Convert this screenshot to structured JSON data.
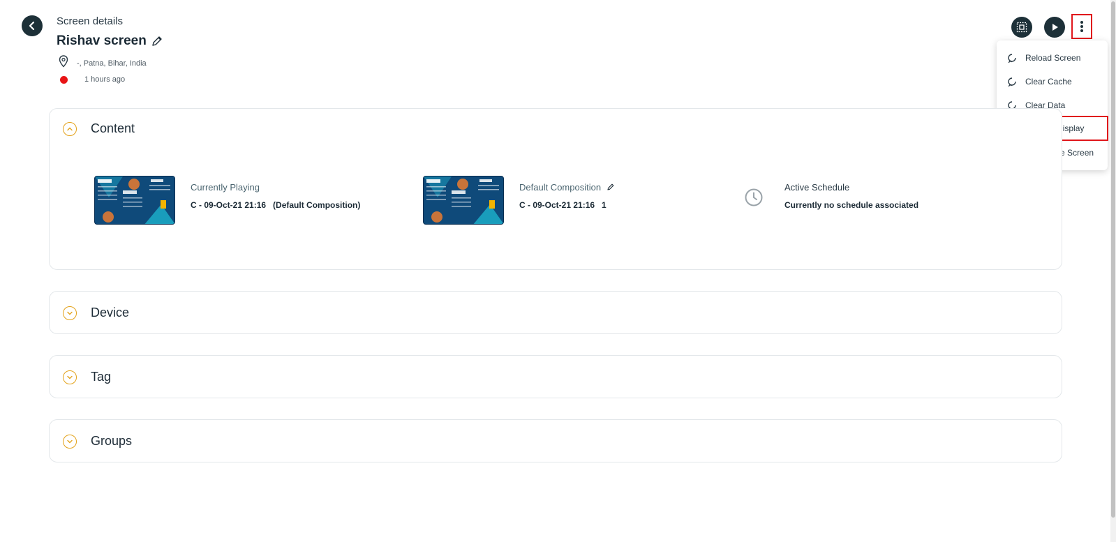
{
  "header": {
    "breadcrumb": "Screen details",
    "screen_name": "Rishav screen",
    "location": "-, Patna, Bihar, India",
    "last_seen": "1 hours ago",
    "status_color": "#e81416"
  },
  "menu": {
    "items": [
      {
        "label": "Reload Screen",
        "icon": "reload-icon"
      },
      {
        "label": "Clear Cache",
        "icon": "reload-icon"
      },
      {
        "label": "Clear Data",
        "icon": "reload-icon"
      },
      {
        "label": "Reboot Display",
        "icon": "refresh-icon"
      },
      {
        "label": "Deactivate Screen",
        "icon": "power-icon"
      }
    ]
  },
  "sections": {
    "content": {
      "title": "Content",
      "currently_playing": {
        "label": "Currently Playing",
        "value": "C - 09-Oct-21 21:16   (Default Composition)"
      },
      "default_composition": {
        "label": "Default Composition",
        "value": "C - 09-Oct-21 21:16   1"
      },
      "active_schedule": {
        "label": "Active Schedule",
        "value": "Currently no schedule associated"
      }
    },
    "device": {
      "title": "Device"
    },
    "tag": {
      "title": "Tag"
    },
    "groups": {
      "title": "Groups"
    }
  },
  "colors": {
    "accent": "#e3a21a",
    "dark": "#1d3038",
    "highlight": "#e0161b"
  }
}
